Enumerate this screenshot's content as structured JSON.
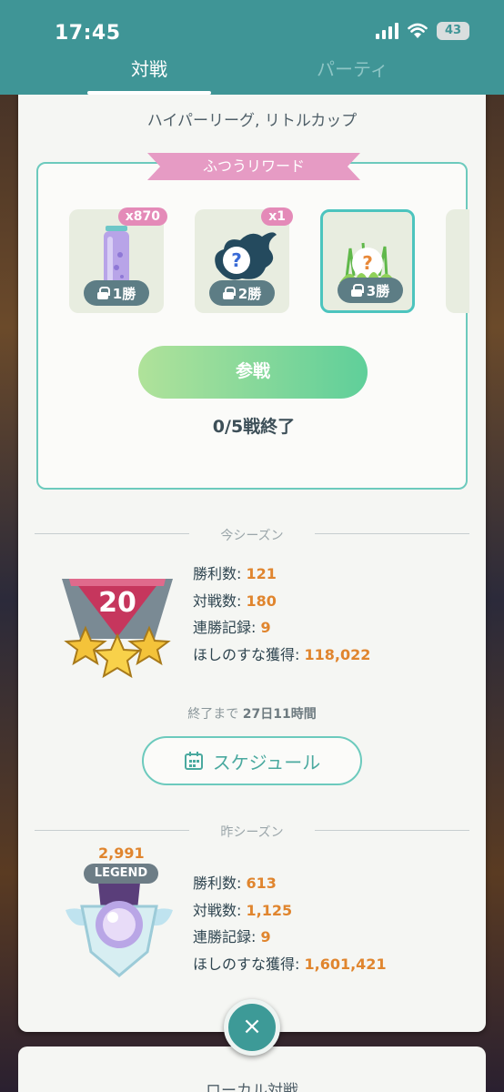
{
  "status_bar": {
    "time": "17:45",
    "battery": "43"
  },
  "tabs": [
    {
      "label": "対戦"
    },
    {
      "label": "パーティ"
    }
  ],
  "league": "ハイパーリーグ, リトルカップ",
  "rewards": {
    "title": "ふつうリワード",
    "items": [
      {
        "icon": "rare-candy-bottle-icon",
        "count": "x870",
        "wins": "1勝"
      },
      {
        "icon": "mystery-pokemon-icon",
        "count": "x1",
        "wins": "2勝"
      },
      {
        "icon": "mystery-egg-in-grass-icon",
        "count": "",
        "wins": "3勝"
      }
    ],
    "join_label": "参戦",
    "battles_done": "0/5戦終了"
  },
  "current_season": {
    "label": "今シーズン",
    "rank": "20",
    "stats": [
      {
        "label": "勝利数: ",
        "value": "121"
      },
      {
        "label": "対戦数: ",
        "value": "180"
      },
      {
        "label": "連勝記録: ",
        "value": "9"
      },
      {
        "label": "ほしのすな獲得: ",
        "value": "118,022"
      }
    ],
    "remaining_prefix": "終了まで ",
    "remaining_value": "27日11時間",
    "schedule_label": "スケジュール"
  },
  "last_season": {
    "label": "昨シーズン",
    "rating": "2,991",
    "rank_badge": "LEGEND",
    "stats": [
      {
        "label": "勝利数: ",
        "value": "613"
      },
      {
        "label": "対戦数: ",
        "value": "1,125"
      },
      {
        "label": "連勝記録: ",
        "value": "9"
      },
      {
        "label": "ほしのすな獲得: ",
        "value": "1,601,421"
      }
    ]
  },
  "close_label": "×",
  "next_card_title": "ローカル対戦",
  "colors": {
    "header": "#3f9596",
    "accent": "#6ccabd",
    "value": "#e0852e",
    "ribbon": "#e69bc4"
  }
}
